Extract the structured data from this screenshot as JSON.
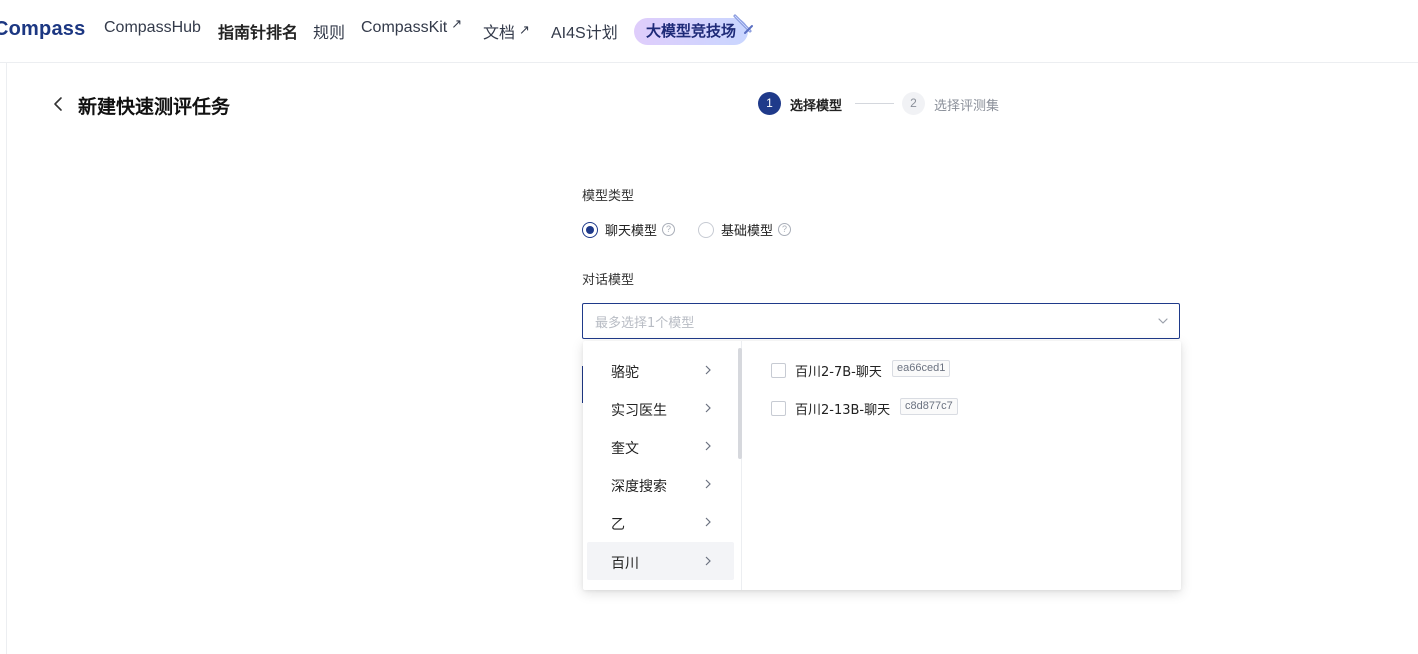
{
  "nav": {
    "logo": "Compass",
    "items": [
      {
        "label": "CompassHub",
        "bold": false,
        "external": false
      },
      {
        "label": "指南针排名",
        "bold": true,
        "external": false
      },
      {
        "label": "规则",
        "bold": false,
        "external": false
      },
      {
        "label": "CompassKit",
        "bold": false,
        "external": true
      },
      {
        "label": "文档",
        "bold": false,
        "external": true
      },
      {
        "label": "AI4S计划",
        "bold": false,
        "external": false
      }
    ],
    "external_arrow": "↗",
    "arena_label": "大模型竞技场"
  },
  "page": {
    "title": "新建快速测评任务"
  },
  "steps": [
    {
      "number": "1",
      "label": "选择模型",
      "active": true
    },
    {
      "number": "2",
      "label": "选择评测集",
      "active": false
    }
  ],
  "form": {
    "model_type_label": "模型类型",
    "model_type_options": [
      {
        "label": "聊天模型",
        "checked": true
      },
      {
        "label": "基础模型",
        "checked": false
      }
    ],
    "help_glyph": "?",
    "dialog_model_label": "对话模型",
    "select_placeholder": "最多选择1个模型"
  },
  "cascader": {
    "categories": [
      {
        "label": "骆驼",
        "selected": false
      },
      {
        "label": "实习医生",
        "selected": false
      },
      {
        "label": "奎文",
        "selected": false
      },
      {
        "label": "深度搜索",
        "selected": false
      },
      {
        "label": "乙",
        "selected": false
      },
      {
        "label": "百川",
        "selected": true
      }
    ],
    "models": [
      {
        "name": "百川2-7B-聊天",
        "tag": "ea66ced1",
        "checked": false
      },
      {
        "name": "百川2-13B-聊天",
        "tag": "c8d877c7",
        "checked": false
      }
    ]
  },
  "colors": {
    "primary": "#1f3a8a",
    "logo": "#1c3782",
    "placeholder": "#b8bcc4"
  }
}
